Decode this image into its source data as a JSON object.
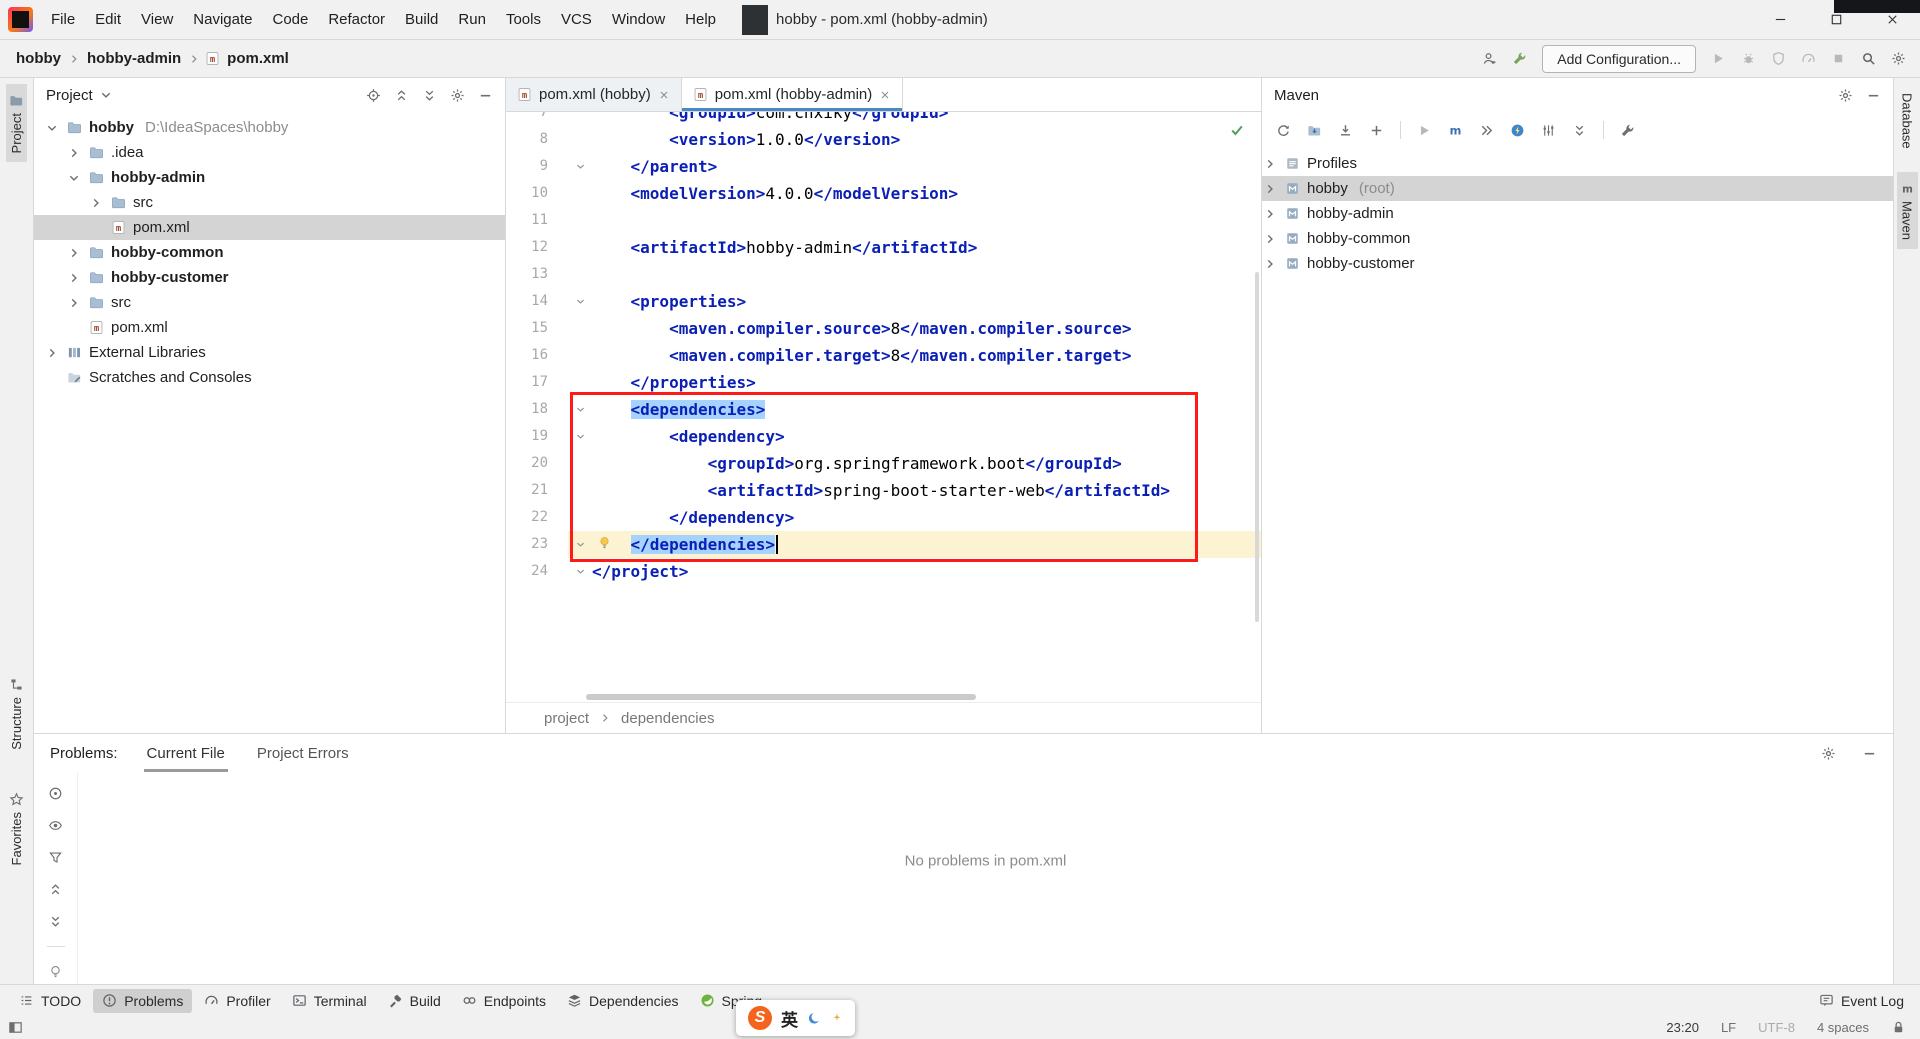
{
  "colors": {
    "tag_blue": "#0A1FB5",
    "selection_blue": "#A6D2FF",
    "current_line": "#FBF3D2",
    "annotation_red": "#FF1A1A",
    "check_green": "#4FA055",
    "spring_green": "#6DB33F",
    "ime_orange": "#F4641E",
    "selected_row_gray": "#D4D4D4"
  },
  "title_bar": {
    "menus": [
      "File",
      "Edit",
      "View",
      "Navigate",
      "Code",
      "Refactor",
      "Build",
      "Run",
      "Tools",
      "VCS",
      "Window",
      "Help"
    ],
    "title": "hobby - pom.xml (hobby-admin)"
  },
  "nav_bar": {
    "breadcrumbs": [
      "hobby",
      "hobby-admin",
      "pom.xml"
    ],
    "add_configuration_label": "Add Configuration...",
    "right_icons_before": [
      "user",
      "wrench"
    ],
    "right_icons_after": [
      "play",
      "bug",
      "shield",
      "gauge",
      "stop",
      "search",
      "gear"
    ]
  },
  "left_stripe": {
    "top": [
      "Project"
    ],
    "bottom": [
      "Structure",
      "Favorites"
    ]
  },
  "right_stripe": {
    "items": [
      "Database",
      "Maven"
    ]
  },
  "project_panel": {
    "title": "Project",
    "header_icons": [
      "target",
      "expand-all",
      "collapse-all",
      "gear",
      "minus"
    ],
    "tree": [
      {
        "level": 0,
        "chevron": "down",
        "icon": "folder",
        "label": "hobby",
        "bold": true,
        "suffix": "D:\\IdeaSpaces\\hobby"
      },
      {
        "level": 1,
        "chevron": "right",
        "icon": "folder",
        "label": ".idea"
      },
      {
        "level": 1,
        "chevron": "down",
        "icon": "folder",
        "label": "hobby-admin",
        "bold": true
      },
      {
        "level": 2,
        "chevron": "right",
        "icon": "folder",
        "label": "src"
      },
      {
        "level": 2,
        "chevron": "none",
        "icon": "maven-file",
        "label": "pom.xml",
        "selected": true
      },
      {
        "level": 1,
        "chevron": "right",
        "icon": "folder",
        "label": "hobby-common",
        "bold": true
      },
      {
        "level": 1,
        "chevron": "right",
        "icon": "folder",
        "label": "hobby-customer",
        "bold": true
      },
      {
        "level": 1,
        "chevron": "right",
        "icon": "folder",
        "label": "src"
      },
      {
        "level": 1,
        "chevron": "none",
        "icon": "maven-file",
        "label": "pom.xml"
      },
      {
        "level": 0,
        "chevron": "right",
        "icon": "libraries",
        "label": "External Libraries"
      },
      {
        "level": 0,
        "chevron": "none",
        "icon": "scratches",
        "label": "Scratches and Consoles"
      }
    ]
  },
  "editor": {
    "tabs": [
      {
        "label": "pom.xml (hobby)",
        "active": false
      },
      {
        "label": "pom.xml (hobby-admin)",
        "active": true
      }
    ],
    "breadcrumbs": [
      "project",
      "dependencies"
    ],
    "lines": [
      {
        "n": 7,
        "indent": 8,
        "partial": true,
        "seg": [
          [
            "tag",
            "<groupId>"
          ],
          [
            "txt",
            "com.cnxiky"
          ],
          [
            "tag",
            "</groupId>"
          ]
        ]
      },
      {
        "n": 8,
        "indent": 8,
        "seg": [
          [
            "tag",
            "<version>"
          ],
          [
            "txt",
            "1.0.0"
          ],
          [
            "tag",
            "</version>"
          ]
        ]
      },
      {
        "n": 9,
        "indent": 4,
        "fold": true,
        "seg": [
          [
            "tag",
            "</parent>"
          ]
        ]
      },
      {
        "n": 10,
        "indent": 4,
        "seg": [
          [
            "tag",
            "<modelVersion>"
          ],
          [
            "txt",
            "4.0.0"
          ],
          [
            "tag",
            "</modelVersion>"
          ]
        ]
      },
      {
        "n": 11,
        "indent": 0,
        "seg": []
      },
      {
        "n": 12,
        "indent": 4,
        "seg": [
          [
            "tag",
            "<artifactId>"
          ],
          [
            "txt",
            "hobby-admin"
          ],
          [
            "tag",
            "</artifactId>"
          ]
        ]
      },
      {
        "n": 13,
        "indent": 0,
        "seg": []
      },
      {
        "n": 14,
        "indent": 4,
        "fold": true,
        "seg": [
          [
            "tag",
            "<properties>"
          ]
        ]
      },
      {
        "n": 15,
        "indent": 8,
        "seg": [
          [
            "tag",
            "<maven.compiler.source>"
          ],
          [
            "txt",
            "8"
          ],
          [
            "tag",
            "</maven.compiler.source>"
          ]
        ]
      },
      {
        "n": 16,
        "indent": 8,
        "seg": [
          [
            "tag",
            "<maven.compiler.target>"
          ],
          [
            "txt",
            "8"
          ],
          [
            "tag",
            "</maven.compiler.target>"
          ]
        ]
      },
      {
        "n": 17,
        "indent": 4,
        "seg": [
          [
            "tag",
            "</properties>"
          ]
        ]
      },
      {
        "n": 18,
        "indent": 4,
        "fold": true,
        "sel": true,
        "seg": [
          [
            "tag",
            "<dependencies>"
          ]
        ]
      },
      {
        "n": 19,
        "indent": 8,
        "fold": true,
        "seg": [
          [
            "tag",
            "<dependency>"
          ]
        ]
      },
      {
        "n": 20,
        "indent": 12,
        "seg": [
          [
            "tag",
            "<groupId>"
          ],
          [
            "txt",
            "org.springframework.boot"
          ],
          [
            "tag",
            "</groupId>"
          ]
        ]
      },
      {
        "n": 21,
        "indent": 12,
        "seg": [
          [
            "tag",
            "<artifactId>"
          ],
          [
            "txt",
            "spring-boot-starter-web"
          ],
          [
            "tag",
            "</artifactId>"
          ]
        ]
      },
      {
        "n": 22,
        "indent": 8,
        "seg": [
          [
            "tag",
            "</dependency>"
          ]
        ]
      },
      {
        "n": 23,
        "indent": 4,
        "fold": true,
        "sel": true,
        "current": true,
        "bulb": true,
        "caret": true,
        "seg": [
          [
            "tag",
            "</dependencies>"
          ]
        ]
      },
      {
        "n": 24,
        "indent": 0,
        "fold": true,
        "seg": [
          [
            "tag",
            "</project>"
          ]
        ]
      }
    ]
  },
  "maven_panel": {
    "title": "Maven",
    "toolbar_icons": [
      "refresh",
      "download-folder",
      "download",
      "plus",
      "|",
      "play",
      "m-goal",
      "skip",
      "bolt",
      "sliders",
      "collapse-all",
      "|",
      "wrench-gray"
    ],
    "tree": [
      {
        "chevron": "right",
        "icon": "profiles",
        "label": "Profiles"
      },
      {
        "chevron": "right",
        "icon": "maven-module",
        "label": "hobby",
        "suffix": "(root)",
        "selected": true
      },
      {
        "chevron": "right",
        "icon": "maven-module",
        "label": "hobby-admin"
      },
      {
        "chevron": "right",
        "icon": "maven-module",
        "label": "hobby-common"
      },
      {
        "chevron": "right",
        "icon": "maven-module",
        "label": "hobby-customer"
      }
    ]
  },
  "problems_panel": {
    "label": "Problems:",
    "tabs": [
      {
        "label": "Current File",
        "active": true
      },
      {
        "label": "Project Errors",
        "active": false
      }
    ],
    "strip_icons": [
      "circle-dot",
      "eye",
      "funnel",
      "expand-all",
      "collapse-all",
      "|",
      "bulb-gray"
    ],
    "empty_message": "No problems in pom.xml"
  },
  "tool_window_bar": {
    "buttons": [
      {
        "label": "TODO",
        "icon": "todo",
        "active": false
      },
      {
        "label": "Problems",
        "icon": "problems-i",
        "active": true
      },
      {
        "label": "Profiler",
        "icon": "gauge2",
        "active": false
      },
      {
        "label": "Terminal",
        "icon": "terminal",
        "active": false
      },
      {
        "label": "Build",
        "icon": "hammer",
        "active": false
      },
      {
        "label": "Endpoints",
        "icon": "endpoints",
        "active": false
      },
      {
        "label": "Dependencies",
        "icon": "deps",
        "active": false
      },
      {
        "label": "Spring",
        "icon": "spring",
        "active": false
      }
    ],
    "event_log_label": "Event Log"
  },
  "status_bar": {
    "time": "23:20",
    "line_separator": "LF",
    "encoding": "UTF-8",
    "indent_info": "4 spaces"
  },
  "ime": {
    "logo_text": "S",
    "language_indicator": "英"
  }
}
